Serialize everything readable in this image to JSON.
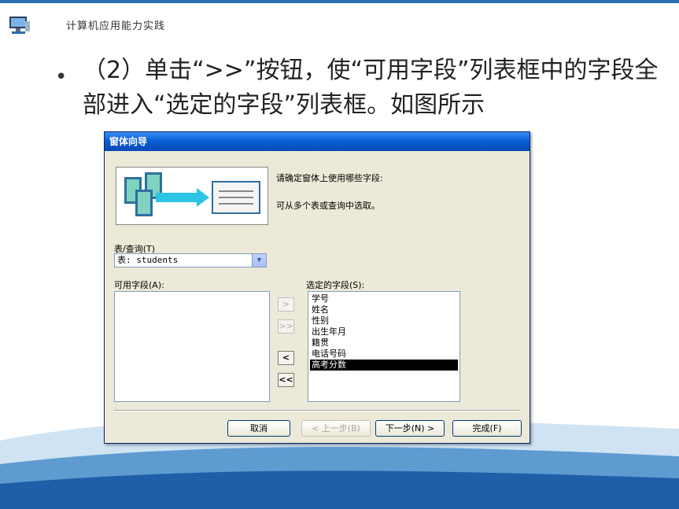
{
  "header": {
    "title": "计算机应用能力实践"
  },
  "slide": {
    "bullet": "•",
    "text": "（2）单击“>>”按钮，使“可用字段”列表框中的字段全部进入“选定的字段”列表框。如图所示"
  },
  "dialog": {
    "title": "窗体向导",
    "prompt1": "请确定窗体上使用哪些字段:",
    "prompt2": "可从多个表或查询中选取。",
    "table_label": "表/查询(T)",
    "table_value": "表: students",
    "available_label": "可用字段(A):",
    "selected_label": "选定的字段(S):",
    "selected_fields": [
      "学号",
      "姓名",
      "性别",
      "出生年月",
      "籍贯",
      "电话号码",
      "高考分数"
    ],
    "selected_index": 6,
    "move_buttons": {
      "add_one": ">",
      "add_all": ">>",
      "remove_one": "<",
      "remove_all": "<<"
    },
    "buttons": {
      "cancel": "取消",
      "back": "< 上一步(B)",
      "next": "下一步(N) >",
      "finish": "完成(F)"
    }
  },
  "colors": {
    "accent": "#2a6fb0",
    "titlebar": "#0a5fd6",
    "wave": "#1f5fa8"
  }
}
